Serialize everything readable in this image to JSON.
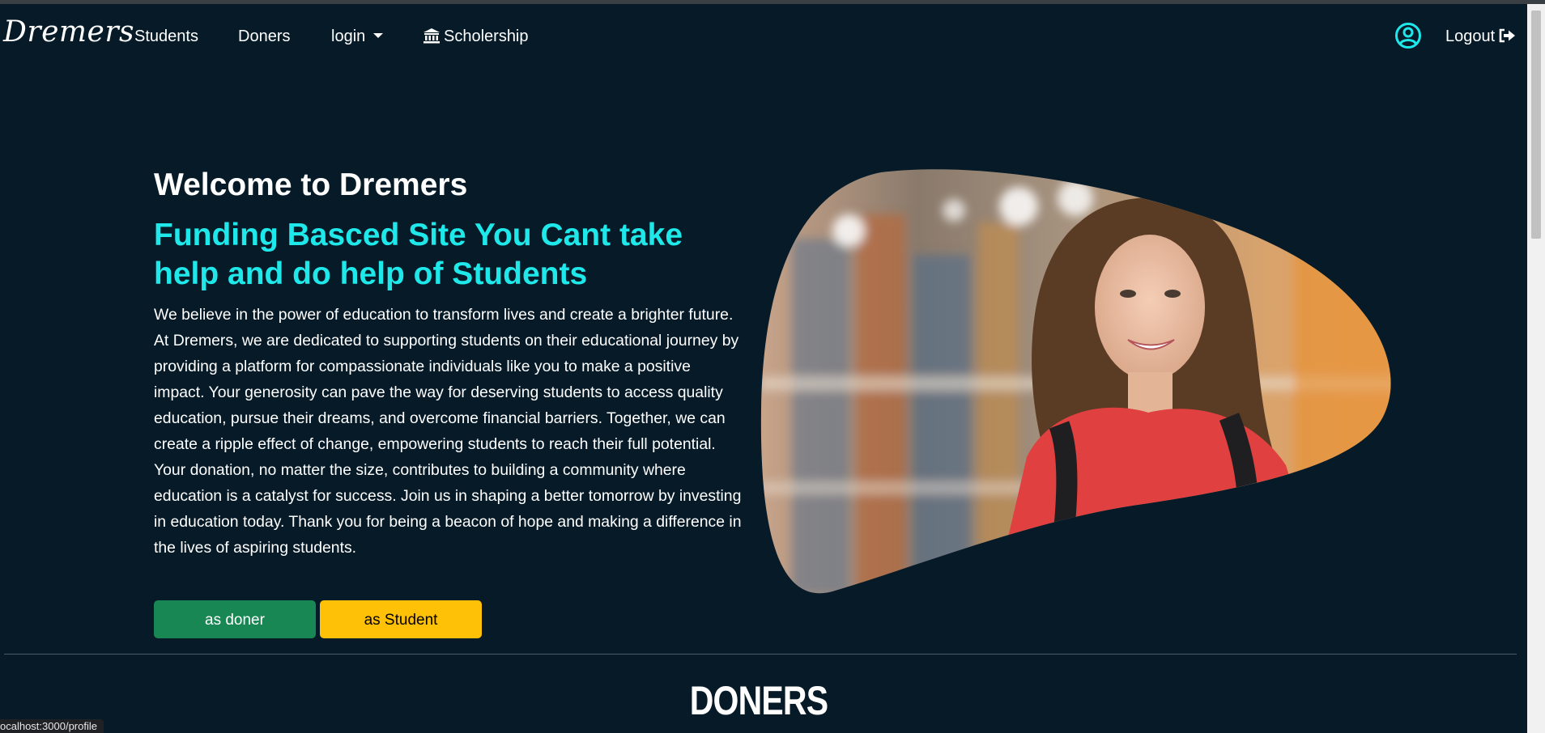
{
  "nav": {
    "brand": "Dremers",
    "links": {
      "students": "Students",
      "doners": "Doners",
      "login": "login",
      "scholarship": "Scholership"
    },
    "logout": "Logout"
  },
  "hero": {
    "title": "Welcome to Dremers",
    "subtitle": "Funding Basced Site You Cant take help and do help of Students",
    "text": "We believe in the power of education to transform lives and create a brighter future. At Dremers, we are dedicated to supporting students on their educational journey by providing a platform for compassionate individuals like you to make a positive impact. Your generosity can pave the way for deserving students to access quality education, pursue their dreams, and overcome financial barriers. Together, we can create a ripple effect of change, empowering students to reach their full potential. Your donation, no matter the size, contributes to building a community where education is a catalyst for success. Join us in shaping a better tomorrow by investing in education today. Thank you for being a beacon of hope and making a difference in the lives of aspiring students.",
    "btn_doner": "as doner",
    "btn_student": "as Student"
  },
  "section": {
    "title": "DONERS"
  },
  "status_bar": {
    "url": "ocalhost:3000/profile"
  },
  "colors": {
    "background": "#061a27",
    "accent": "#1ee8ea",
    "doner_button": "#198754",
    "student_button": "#ffc107"
  },
  "icons": {
    "scholarship": "bank-icon",
    "profile": "user-circle-icon",
    "logout": "sign-out-icon",
    "login_dropdown": "caret-down-icon"
  }
}
